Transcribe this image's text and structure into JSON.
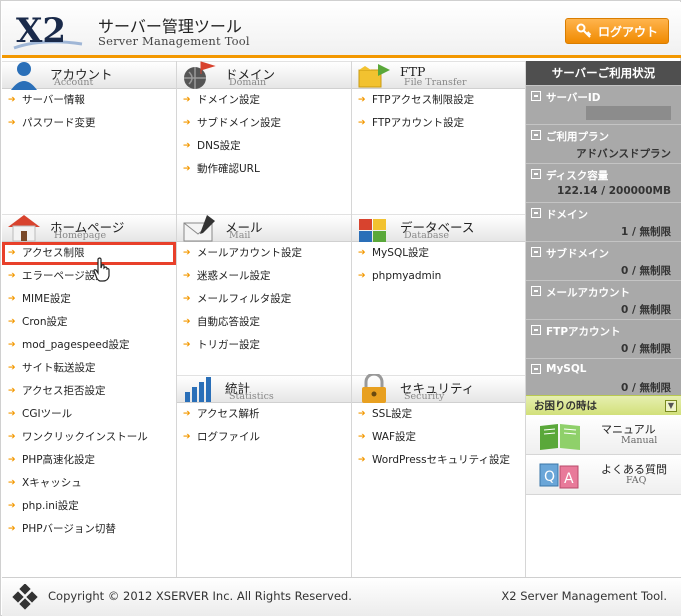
{
  "header": {
    "logo_text": "X2",
    "title": "サーバー管理ツール",
    "subtitle": "Server Management Tool",
    "logout_label": "ログアウト"
  },
  "sections": {
    "account": {
      "title": "アカウント",
      "subtitle": "Account",
      "items": [
        "サーバー情報",
        "パスワード変更"
      ]
    },
    "domain": {
      "title": "ドメイン",
      "subtitle": "Domain",
      "items": [
        "ドメイン設定",
        "サブドメイン設定",
        "DNS設定",
        "動作確認URL"
      ]
    },
    "ftp": {
      "title": "FTP",
      "subtitle": "File Transfer",
      "items": [
        "FTPアクセス制限設定",
        "FTPアカウント設定"
      ]
    },
    "homepage": {
      "title": "ホームページ",
      "subtitle": "Homepage",
      "items": [
        "アクセス制限",
        "エラーページ設定",
        "MIME設定",
        "Cron設定",
        "mod_pagespeed設定",
        "サイト転送設定",
        "アクセス拒否設定",
        "CGIツール",
        "ワンクリックインストール",
        "PHP高速化設定",
        "Xキャッシュ",
        "php.ini設定",
        "PHPバージョン切替"
      ]
    },
    "mail": {
      "title": "メール",
      "subtitle": "Mail",
      "items": [
        "メールアカウント設定",
        "迷惑メール設定",
        "メールフィルタ設定",
        "自動応答設定",
        "トリガー設定"
      ]
    },
    "database": {
      "title": "データベース",
      "subtitle": "Database",
      "items": [
        "MySQL設定",
        "phpmyadmin"
      ]
    },
    "statistics": {
      "title": "統計",
      "subtitle": "Statistics",
      "items": [
        "アクセス解析",
        "ログファイル"
      ]
    },
    "security": {
      "title": "セキュリティ",
      "subtitle": "Security",
      "items": [
        "SSL設定",
        "WAF設定",
        "WordPressセキュリティ設定"
      ]
    }
  },
  "sidebar": {
    "title": "サーバーご利用状況",
    "stats": [
      {
        "label": "サーバーID",
        "value": ""
      },
      {
        "label": "ご利用プラン",
        "value": "アドバンスドプラン"
      },
      {
        "label": "ディスク容量",
        "value": "122.14 / 200000MB"
      },
      {
        "label": "ドメイン",
        "value": "1 / 無制限"
      },
      {
        "label": "サブドメイン",
        "value": "0 / 無制限"
      },
      {
        "label": "メールアカウント",
        "value": "0 / 無制限"
      },
      {
        "label": "FTPアカウント",
        "value": "0 / 無制限"
      },
      {
        "label": "MySQL",
        "value": "0 / 無制限"
      }
    ],
    "help_title": "お困りの時は",
    "help_items": [
      {
        "label": "マニュアル",
        "sub": "Manual"
      },
      {
        "label": "よくある質問",
        "sub": "FAQ"
      }
    ]
  },
  "footer": {
    "copyright": "Copyright © 2012  XSERVER Inc.  All Rights Reserved.",
    "right": "X2 Server Management Tool."
  },
  "colors": {
    "accent": "#f39800",
    "highlight": "#e8402a",
    "sidebar_gray": "#a9a9a9"
  }
}
